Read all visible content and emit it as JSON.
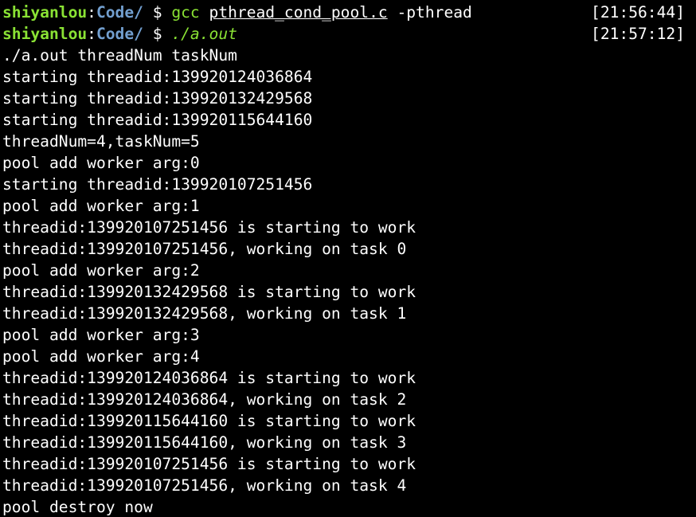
{
  "terminal": {
    "prompts": [
      {
        "user": "shiyanlou",
        "sep": ":",
        "path": "Code/",
        "dollar": " $ ",
        "cmd": "gcc",
        "arg1": "pthread_cond_pool.c",
        "arg2": " -pthread",
        "timestamp": "[21:56:44]"
      },
      {
        "user": "shiyanlou",
        "sep": ":",
        "path": "Code/",
        "dollar": " $ ",
        "cmd": "./a.out",
        "timestamp": "[21:57:12]"
      }
    ],
    "output": [
      "./a.out threadNum taskNum",
      "starting threadid:139920124036864",
      "starting threadid:139920132429568",
      "starting threadid:139920115644160",
      "threadNum=4,taskNum=5",
      "pool add worker arg:0",
      "starting threadid:139920107251456",
      "pool add worker arg:1",
      "threadid:139920107251456 is starting to work",
      "threadid:139920107251456, working on task 0",
      "pool add worker arg:2",
      "threadid:139920132429568 is starting to work",
      "threadid:139920132429568, working on task 1",
      "pool add worker arg:3",
      "pool add worker arg:4",
      "threadid:139920124036864 is starting to work",
      "threadid:139920124036864, working on task 2",
      "threadid:139920115644160 is starting to work",
      "threadid:139920115644160, working on task 3",
      "threadid:139920107251456 is starting to work",
      "threadid:139920107251456, working on task 4",
      "pool destroy now"
    ]
  },
  "colors": {
    "background": "#000000",
    "text": "#ffffff",
    "prompt_user": "#8ae234",
    "prompt_path": "#729fcf"
  }
}
